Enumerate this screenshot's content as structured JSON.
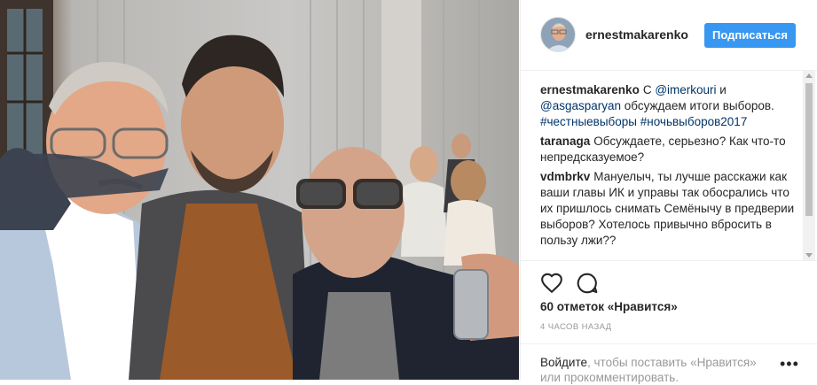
{
  "post": {
    "username": "ernestmakarenko",
    "follow_label": "Подписаться",
    "caption": {
      "author": "ernestmakarenko",
      "parts": [
        "С ",
        "@imerkouri",
        " и ",
        "@asgasparyan",
        " обсуждаем итоги выборов. ",
        "#честныевыборы",
        " ",
        "#ночьвыборов2017"
      ]
    },
    "comments": [
      {
        "author": "taranaga",
        "text": "Обсуждаете, серьезно? Как что-то непредсказуемое?"
      },
      {
        "author": "vdmbrkv",
        "text": "Мануелыч, ты лучше расскажи как ваши главы ИК и управы так обосрались что их пришлось снимать Семёнычу в предверии выборов? Хотелось привычно вбросить в пользу лжи??"
      }
    ],
    "likes_text": "60 отметок «Нравится»",
    "time_ago": "4 ЧАСОВ НАЗАД",
    "login_link": "Войдите",
    "login_text": ", чтобы поставить «Нравится» или прокомментировать.",
    "more_label": "•••"
  },
  "icons": {
    "like": "heart-icon",
    "comment": "comment-icon"
  }
}
